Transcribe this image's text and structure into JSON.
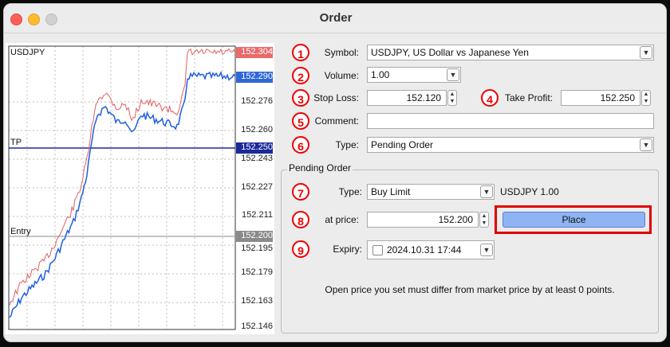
{
  "window": {
    "title": "Order"
  },
  "chart": {
    "symbol": "USDJPY",
    "tp_label": "TP",
    "entry_label": "Entry",
    "scale_labels": [
      "152.276",
      "152.260",
      "152.243",
      "152.227",
      "152.211",
      "152.195",
      "152.179",
      "152.163",
      "152.146"
    ],
    "ask_price": "152.304",
    "bid_price": "152.290",
    "tp_price": "152.250",
    "entry_price": "152.200",
    "colors": {
      "ask": "#e06060",
      "bid": "#1f5fe0",
      "tp": "#1a2a9a",
      "entry": "#8a8a8a"
    }
  },
  "form": {
    "symbol": {
      "number": "1",
      "label": "Symbol:",
      "value": "USDJPY, US Dollar vs Japanese Yen"
    },
    "volume": {
      "number": "2",
      "label": "Volume:",
      "value": "1.00"
    },
    "stop_loss": {
      "number": "3",
      "label": "Stop Loss:",
      "value": "152.120"
    },
    "take_profit": {
      "number": "4",
      "label": "Take Profit:",
      "value": "152.250"
    },
    "comment": {
      "number": "5",
      "label": "Comment:",
      "value": ""
    },
    "type": {
      "number": "6",
      "label": "Type:",
      "value": "Pending Order"
    }
  },
  "pending": {
    "group_title": "Pending Order",
    "type": {
      "number": "7",
      "label": "Type:",
      "value": "Buy Limit",
      "info": "USDJPY 1.00"
    },
    "price": {
      "number": "8",
      "label": "at price:",
      "value": "152.200"
    },
    "expiry": {
      "number": "9",
      "label": "Expiry:",
      "value": "2024.10.31 17:44"
    },
    "place_label": "Place",
    "note": "Open price you set must differ from market price by at least 0 points."
  }
}
